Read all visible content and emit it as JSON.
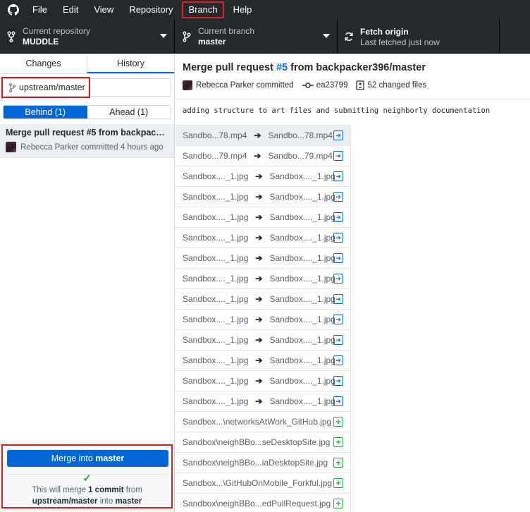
{
  "menu": {
    "items": [
      "File",
      "Edit",
      "View",
      "Repository",
      "Branch",
      "Help"
    ],
    "highlighted": "Branch"
  },
  "toolbar": {
    "repo_label": "Current repository",
    "repo_value": "MUDDLE",
    "branch_label": "Current branch",
    "branch_value": "master",
    "fetch_label": "Fetch origin",
    "fetch_sub": "Last fetched just now"
  },
  "sidebar": {
    "tabs": [
      "Changes",
      "History"
    ],
    "active_tab": "History",
    "branch_filter": "upstream/master",
    "segments": [
      "Behind (1)",
      "Ahead (1)"
    ],
    "active_segment": "Behind (1)",
    "commit": {
      "title": "Merge pull request #5 from backpacker396/master",
      "meta": "Rebecca Parker committed 4 hours ago"
    },
    "merge": {
      "button_prefix": "Merge into ",
      "button_branch": "master",
      "msg_1": "This will merge ",
      "msg_count": "1 commit",
      "msg_2": " from",
      "msg_from": "upstream/master",
      "msg_3": " into ",
      "msg_into": "master"
    }
  },
  "commit_detail": {
    "title_prefix": "Merge pull request ",
    "pr_number": "#5",
    "title_suffix": " from backpacker396/master",
    "author": "Rebecca Parker committed",
    "sha": "ea23799",
    "changed_files": "52 changed files",
    "description": "adding structure to art files and submitting neighborly documentation"
  },
  "files": [
    {
      "old": "Sandbo...78.mp4",
      "new": "Sandbo...78.mp4",
      "status": "renamed",
      "selected": true
    },
    {
      "old": "Sandbo...79.mp4",
      "new": "Sandbo...79.mp4",
      "status": "renamed"
    },
    {
      "old": "Sandbox...._1.jpg",
      "new": "Sandbox...._1.jpg",
      "status": "renamed"
    },
    {
      "old": "Sandbox...._1.jpg",
      "new": "Sandbox...._1.jpg",
      "status": "renamed"
    },
    {
      "old": "Sandbox...._1.jpg",
      "new": "Sandbox...._1.jpg",
      "status": "renamed"
    },
    {
      "old": "Sandbox...._1.jpg",
      "new": "Sandbox...._1.jpg",
      "status": "renamed"
    },
    {
      "old": "Sandbox...._1.jpg",
      "new": "Sandbox...._1.jpg",
      "status": "renamed"
    },
    {
      "old": "Sandbox...._1.jpg",
      "new": "Sandbox...._1.jpg",
      "status": "renamed"
    },
    {
      "old": "Sandbox...._1.jpg",
      "new": "Sandbox...._1.jpg",
      "status": "renamed"
    },
    {
      "old": "Sandbox...._1.jpg",
      "new": "Sandbox...._1.jpg",
      "status": "renamed"
    },
    {
      "old": "Sandbox...._1.jpg",
      "new": "Sandbox...._1.jpg",
      "status": "renamed"
    },
    {
      "old": "Sandbox...._1.jpg",
      "new": "Sandbox...._1.jpg",
      "status": "renamed"
    },
    {
      "old": "Sandbox...._1.jpg",
      "new": "Sandbox...._1.jpg",
      "status": "renamed"
    },
    {
      "old": "Sandbox...._1.jpg",
      "new": "Sandbox...._1.jpg",
      "status": "renamed"
    },
    {
      "name": "Sandbox...\\networksAtWork_GitHub.jpg",
      "status": "added"
    },
    {
      "name": "Sandbox\\neighBBo...seDesktopSite.jpg",
      "status": "added"
    },
    {
      "name": "Sandbox\\neighBBo...iaDesktopSite.jpg",
      "status": "added"
    },
    {
      "name": "Sandbox...\\GitHubOnMobile_Forkful.jpg",
      "status": "added"
    },
    {
      "name": "Sandbox\\neighBBo...edPullRequest.jpg",
      "status": "added"
    }
  ],
  "colors": {
    "titlebar": "#24292e",
    "accent": "#0366d6",
    "added": "#28a745",
    "highlight": "#d81c1c"
  }
}
